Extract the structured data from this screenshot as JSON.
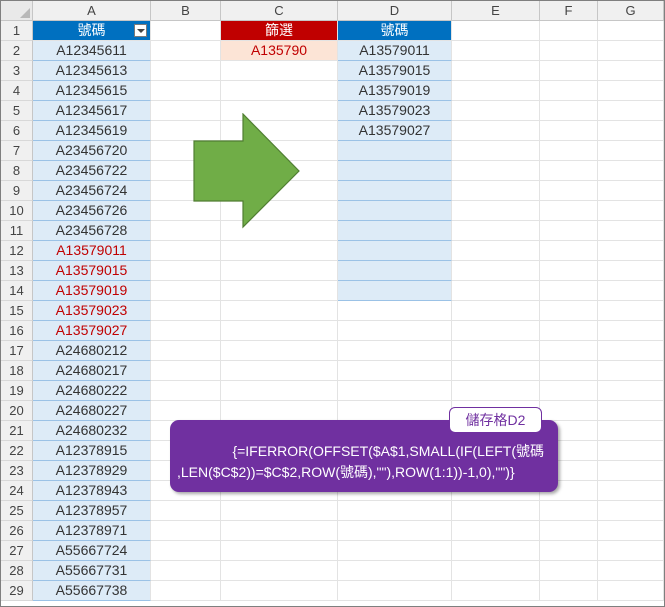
{
  "columns": [
    "A",
    "B",
    "C",
    "D",
    "E",
    "F",
    "G"
  ],
  "rows": [
    "1",
    "2",
    "3",
    "4",
    "5",
    "6",
    "7",
    "8",
    "9",
    "10",
    "11",
    "12",
    "13",
    "14",
    "15",
    "16",
    "17",
    "18",
    "19",
    "20",
    "21",
    "22",
    "23",
    "24",
    "25",
    "26",
    "27",
    "28",
    "29"
  ],
  "headers": {
    "A": "號碼",
    "C": "篩選",
    "D": "號碼"
  },
  "filter_value": "A135790",
  "column_a": [
    "A12345611",
    "A12345613",
    "A12345615",
    "A12345617",
    "A12345619",
    "A23456720",
    "A23456722",
    "A23456724",
    "A23456726",
    "A23456728",
    "A13579011",
    "A13579015",
    "A13579019",
    "A13579023",
    "A13579027",
    "A24680212",
    "A24680217",
    "A24680222",
    "A24680227",
    "A24680232",
    "A12378915",
    "A12378929",
    "A12378943",
    "A12378957",
    "A12378971",
    "A55667724",
    "A55667731",
    "A55667738"
  ],
  "column_a_highlight": [
    false,
    false,
    false,
    false,
    false,
    false,
    false,
    false,
    false,
    false,
    true,
    true,
    true,
    true,
    true,
    false,
    false,
    false,
    false,
    false,
    false,
    false,
    false,
    false,
    false,
    false,
    false,
    false
  ],
  "column_d": [
    "A13579011",
    "A13579015",
    "A13579019",
    "A13579023",
    "A13579027",
    "",
    "",
    "",
    "",
    "",
    "",
    "",
    ""
  ],
  "callout": {
    "tag": "儲存格D2",
    "line1": "{=IFERROR(OFFSET($A$1,SMALL(IF(LEFT(號碼",
    "line2": ",LEN($C$2))=$C$2,ROW(號碼),\"\"),ROW(1:1))-1,0),\"\")}"
  },
  "colors": {
    "blue_header": "#0070c0",
    "red_header": "#c00000",
    "arrow_green": "#70ad47",
    "callout_purple": "#7030a0"
  }
}
